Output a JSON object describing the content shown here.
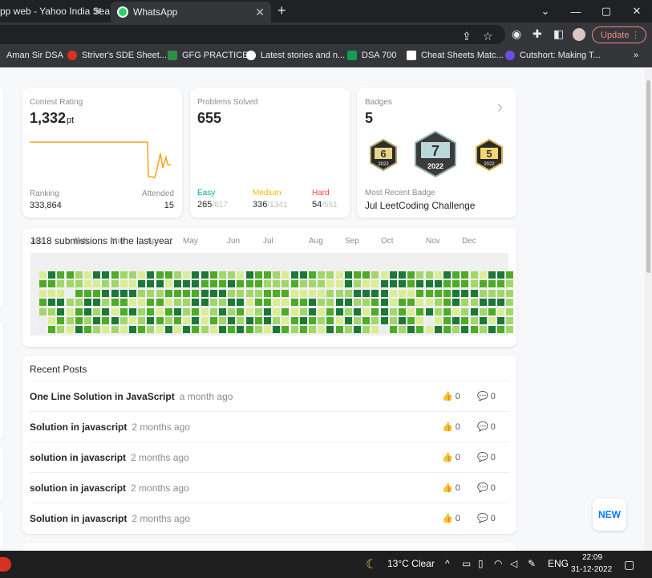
{
  "browser": {
    "tabs": [
      {
        "title": "pp web - Yahoo India Sea",
        "close": "✕"
      },
      {
        "title": "WhatsApp",
        "close": "✕"
      }
    ],
    "new_tab": "+",
    "window_controls": [
      "⌄",
      "—",
      "▢",
      "✕"
    ],
    "update_label": "Update",
    "bookmarks": [
      {
        "label": "Aman Sir DSA",
        "color": "#f9ab00"
      },
      {
        "label": "Striver's SDE Sheet...",
        "color": "#d93025"
      },
      {
        "label": "GFG PRACTICE",
        "color": "#2f8d46"
      },
      {
        "label": "Latest stories and n...",
        "color": "#ffffff"
      },
      {
        "label": "DSA 700",
        "color": "#0f9d58"
      },
      {
        "label": "Cheat Sheets Matc...",
        "color": "#ffffff"
      },
      {
        "label": "Cutshort: Making T...",
        "color": "#6c4ee6"
      }
    ],
    "bookmarks_more": "»"
  },
  "contest": {
    "label": "Contest Rating",
    "rating": "1,332",
    "unit": "pt",
    "ranking_label": "Ranking",
    "ranking": "333,864",
    "attended_label": "Attended",
    "attended": "15",
    "line_color": "#ffa116"
  },
  "problems": {
    "label": "Problems Solved",
    "total": "655",
    "easy_label": "Easy",
    "easy": "265",
    "easy_total": "/617",
    "medium_label": "Medium",
    "medium": "336",
    "medium_total": "/1341",
    "hard_label": "Hard",
    "hard": "54",
    "hard_total": "/561",
    "colors": {
      "easy": "#00af9b",
      "medium": "#ffb800",
      "hard": "#ef4743"
    }
  },
  "badges": {
    "label": "Badges",
    "count": "5",
    "items": [
      {
        "number": "6",
        "year": "2022"
      },
      {
        "number": "7",
        "year": "2022"
      },
      {
        "number": "5",
        "year": "2022"
      }
    ],
    "recent_label": "Most Recent Badge",
    "recent_name": "Jul LeetCoding Challenge",
    "chevron": "›"
  },
  "submissions": {
    "title": "1318 submissions in the last year",
    "months": [
      "Jan",
      "Feb",
      "Mar",
      "Apr",
      "May",
      "Jun",
      "Jul",
      "Aug",
      "Sep",
      "Oct",
      "Nov",
      "Dec"
    ],
    "levels_colors": [
      "#ebedf0",
      "#d9ed92",
      "#a1d76a",
      "#4dac26",
      "#1b7837"
    ]
  },
  "posts": {
    "title": "Recent Posts",
    "items": [
      {
        "title": "One Line Solution in JavaScript",
        "time": "a month ago",
        "votes": "0",
        "comments": "0"
      },
      {
        "title": "Solution in javascript",
        "time": "2 months ago",
        "votes": "0",
        "comments": "0"
      },
      {
        "title": "solution in javascript",
        "time": "2 months ago",
        "votes": "0",
        "comments": "0"
      },
      {
        "title": "solution in javascript",
        "time": "2 months ago",
        "votes": "0",
        "comments": "0"
      },
      {
        "title": "Solution in javascript",
        "time": "2 months ago",
        "votes": "0",
        "comments": "0"
      }
    ]
  },
  "new_button": "NEW",
  "taskbar": {
    "weather": "13°C  Clear",
    "lang": "ENG",
    "time": "22:09",
    "date": "31-12-2022"
  }
}
